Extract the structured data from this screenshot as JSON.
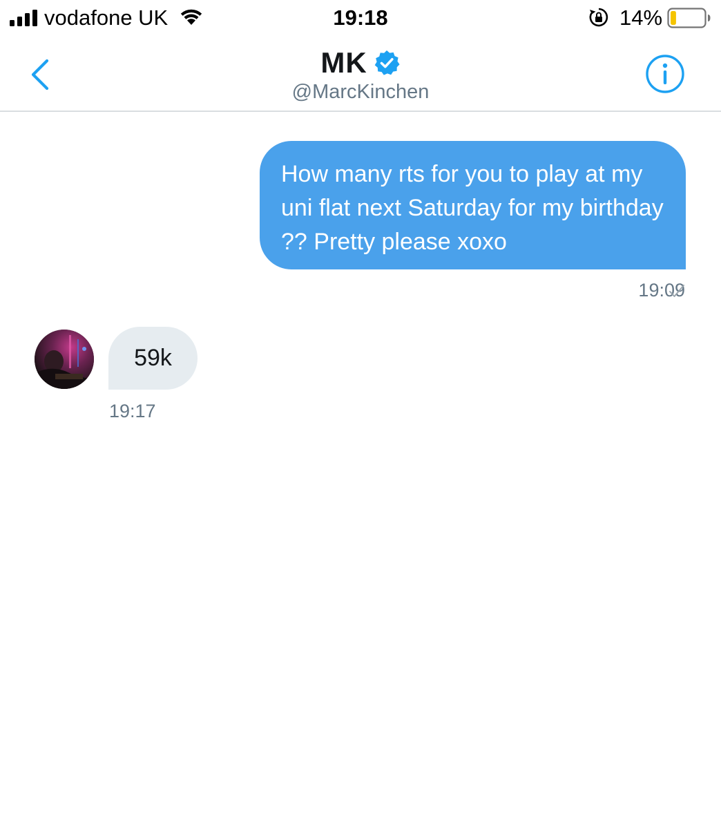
{
  "status_bar": {
    "carrier": "vodafone UK",
    "time": "19:18",
    "battery_percent": "14%",
    "battery_level": 0.14,
    "battery_color": "#f5c400",
    "icons": [
      "signal-icon",
      "wifi-icon",
      "rotation-lock-icon",
      "battery-icon"
    ]
  },
  "header": {
    "name": "MK",
    "handle": "@MarcKinchen",
    "verified": true,
    "accent_color": "#1da1f2",
    "icons": [
      "back-chevron-icon",
      "verified-badge-icon",
      "info-icon"
    ]
  },
  "conversation": {
    "sent": {
      "text": "How many rts for you to play at my uni flat next Saturday for my birthday ?? Pretty please xoxo",
      "time": "19:09",
      "status_icon": "checkmark-icon",
      "bubble_color": "#4aa1eb"
    },
    "received": {
      "text": "59k",
      "time": "19:17",
      "bubble_color": "#e6ecf0",
      "avatar_icon": "avatar-photo"
    }
  }
}
